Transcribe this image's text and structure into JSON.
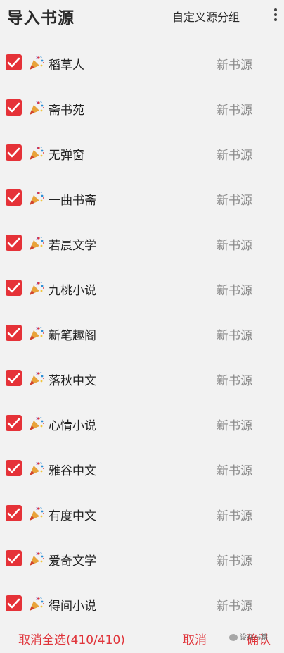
{
  "header": {
    "title": "导入书源",
    "group_label": "自定义源分组",
    "more_icon": "more-vertical-icon"
  },
  "colors": {
    "accent": "#e53238",
    "background": "#f2f2f2",
    "tag_text": "#8a8a8a"
  },
  "items": [
    {
      "name": "稻草人",
      "tag": "新书源",
      "checked": true
    },
    {
      "name": "斋书苑",
      "tag": "新书源",
      "checked": true
    },
    {
      "name": "无弹窗",
      "tag": "新书源",
      "checked": true
    },
    {
      "name": "一曲书斋",
      "tag": "新书源",
      "checked": true
    },
    {
      "name": "若晨文学",
      "tag": "新书源",
      "checked": true
    },
    {
      "name": "九桃小说",
      "tag": "新书源",
      "checked": true
    },
    {
      "name": "新笔趣阁",
      "tag": "新书源",
      "checked": true
    },
    {
      "name": "落秋中文",
      "tag": "新书源",
      "checked": true
    },
    {
      "name": "心情小说",
      "tag": "新书源",
      "checked": true
    },
    {
      "name": "雅谷中文",
      "tag": "新书源",
      "checked": true
    },
    {
      "name": "有度中文",
      "tag": "新书源",
      "checked": true
    },
    {
      "name": "爱奇文学",
      "tag": "新书源",
      "checked": true
    },
    {
      "name": "得间小说",
      "tag": "新书源",
      "checked": true
    }
  ],
  "footer": {
    "deselect_all": "取消全选(410/410)",
    "cancel": "取消",
    "confirm": "确认"
  },
  "watermark": "设在书籍"
}
